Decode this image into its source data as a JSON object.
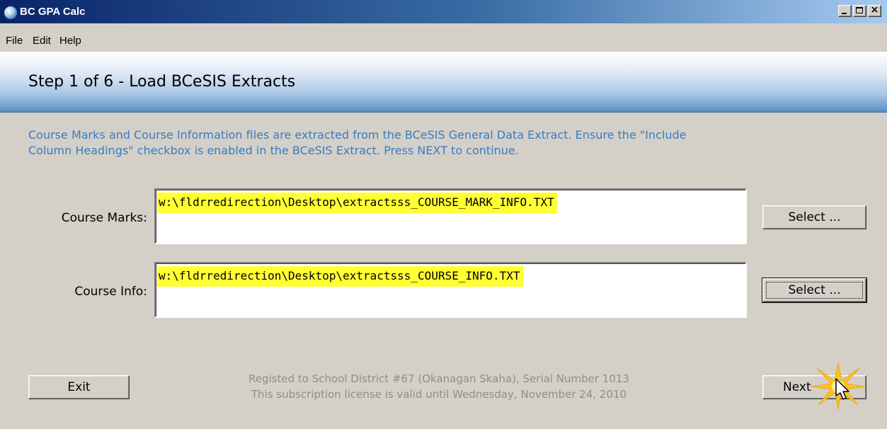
{
  "window": {
    "title": "BC GPA Calc"
  },
  "menu": {
    "items": [
      "File",
      "Edit",
      "Help"
    ]
  },
  "step": {
    "title": "Step 1 of 6 - Load BCeSIS Extracts"
  },
  "instructions": {
    "line1": "Course Marks and Course Information files are extracted from the BCeSIS General Data Extract. Ensure the \"Include",
    "line2": "Column Headings\" checkbox is enabled in the BCeSIS Extract. Press NEXT to continue."
  },
  "fields": {
    "course_marks": {
      "label": "Course Marks:",
      "value": "w:\\fldrredirection\\Desktop\\extractsss_COURSE_MARK_INFO.TXT",
      "button": "Select ..."
    },
    "course_info": {
      "label": "Course Info:",
      "value": "w:\\fldrredirection\\Desktop\\extractsss_COURSE_INFO.TXT",
      "button": "Select ..."
    }
  },
  "buttons": {
    "exit": "Exit",
    "next": "Next"
  },
  "footer": {
    "line1": "Registed to School District #67 (Okanagan Skaha), Serial Number 1013",
    "line2": "This subscription license is valid until Wednesday, November 24, 2010"
  },
  "colors": {
    "titlebar_start": "#0a246a",
    "instruction_text": "#3a7cc0",
    "highlight": "#ffff33",
    "face": "#d4d0c8"
  }
}
